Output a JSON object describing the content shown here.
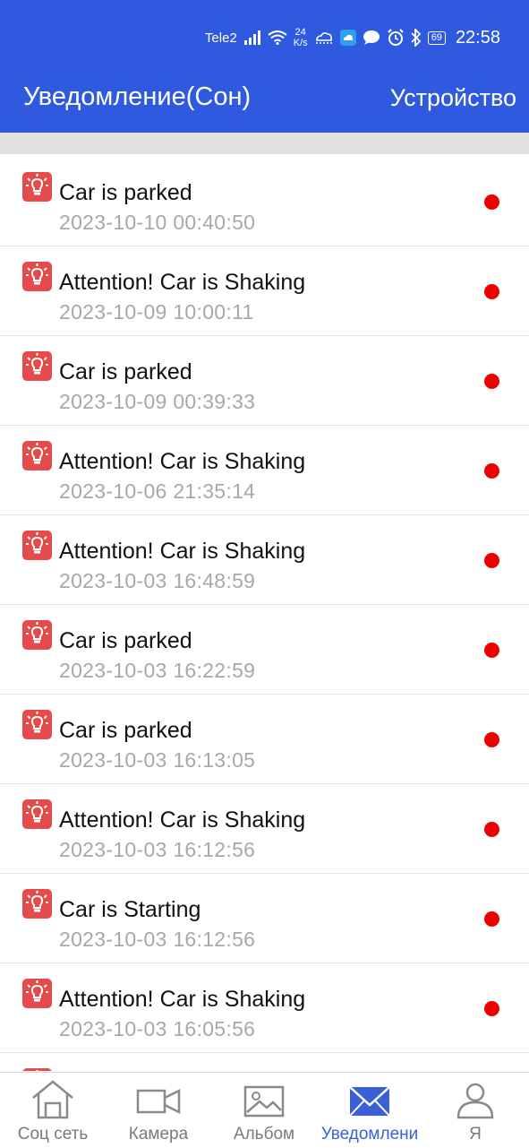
{
  "status_bar": {
    "carrier": "Tele2",
    "speed_value": "24",
    "speed_unit": "K/s",
    "battery": "69",
    "time": "22:58"
  },
  "header": {
    "title": "Уведомление(Сон)",
    "device_label": "Устройство"
  },
  "notifications": [
    {
      "text": "Car is parked",
      "date": "2023-10-10 00:40:50"
    },
    {
      "text": "Attention! Car is Shaking",
      "date": "2023-10-09 10:00:11"
    },
    {
      "text": "Car is parked",
      "date": "2023-10-09 00:39:33"
    },
    {
      "text": "Attention! Car is Shaking",
      "date": "2023-10-06 21:35:14"
    },
    {
      "text": "Attention! Car is Shaking",
      "date": "2023-10-03 16:48:59"
    },
    {
      "text": "Car is parked",
      "date": "2023-10-03 16:22:59"
    },
    {
      "text": "Car is parked",
      "date": "2023-10-03 16:13:05"
    },
    {
      "text": "Attention! Car is Shaking",
      "date": "2023-10-03 16:12:56"
    },
    {
      "text": "Car is Starting",
      "date": "2023-10-03 16:12:56"
    },
    {
      "text": "Attention! Car is Shaking",
      "date": "2023-10-03 16:05:56"
    }
  ],
  "tabs": [
    {
      "label": "Соц сеть",
      "icon": "home-icon"
    },
    {
      "label": "Камера",
      "icon": "video-camera-icon"
    },
    {
      "label": "Альбом",
      "icon": "image-icon"
    },
    {
      "label": "Уведомлени",
      "icon": "envelope-icon",
      "active": true
    },
    {
      "label": "Я",
      "icon": "person-icon"
    }
  ],
  "colors": {
    "header": "#2f5ae0",
    "unread_dot": "#ee0000",
    "alert_icon": "#e54b4b",
    "active_tab": "#3a5fd6"
  }
}
